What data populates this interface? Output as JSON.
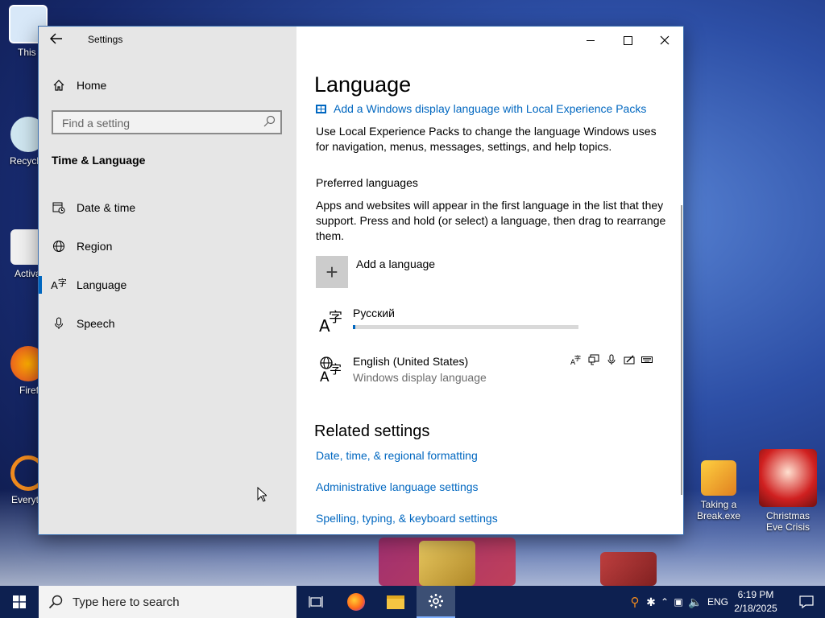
{
  "desktop": {
    "icons": [
      {
        "label": "This"
      },
      {
        "label": "Recycl"
      },
      {
        "label": "Activa"
      },
      {
        "label": "Firef"
      },
      {
        "label": "Everyt"
      },
      {
        "label": "Taking a Break.exe"
      },
      {
        "label": "Christmas Eve Crisis"
      }
    ]
  },
  "window": {
    "title": "Settings",
    "back_icon": "back-arrow-icon",
    "controls": [
      "minimize",
      "maximize",
      "close"
    ]
  },
  "sidebar": {
    "home_label": "Home",
    "search_placeholder": "Find a setting",
    "section_title": "Time & Language",
    "items": [
      {
        "label": "Date & time",
        "icon": "calendar-clock-icon"
      },
      {
        "label": "Region",
        "icon": "globe-icon"
      },
      {
        "label": "Language",
        "icon": "language-icon",
        "selected": true
      },
      {
        "label": "Speech",
        "icon": "microphone-icon"
      }
    ]
  },
  "main": {
    "page_title": "Language",
    "lep_link": "Add a Windows display language with Local Experience Packs",
    "lep_desc": "Use Local Experience Packs to change the language Windows uses for navigation, menus, messages, settings, and help topics.",
    "preferred_heading": "Preferred languages",
    "preferred_desc": "Apps and websites will appear in the first language in the list that they support. Press and hold (or select) a language, then drag to rearrange them.",
    "add_language_label": "Add a language",
    "languages": [
      {
        "name": "Русский",
        "downloading": true,
        "progress_percent": 1
      },
      {
        "name": "English (United States)",
        "sub": "Windows display language",
        "feature_icons": [
          "language-pack-icon",
          "display-language-icon",
          "speech-icon",
          "handwriting-icon",
          "keyboard-icon"
        ]
      }
    ],
    "related_title": "Related settings",
    "related_links": [
      "Date, time, & regional formatting",
      "Administrative language settings",
      "Spelling, typing, & keyboard settings"
    ]
  },
  "taskbar": {
    "search_placeholder": "Type here to search",
    "tray_lang": "ENG",
    "time": "6:19 PM",
    "date": "2/18/2025"
  },
  "colors": {
    "accent": "#0067c0",
    "sidebar_bg": "#e6e6e6",
    "taskbar_bg": "#0d2050"
  }
}
